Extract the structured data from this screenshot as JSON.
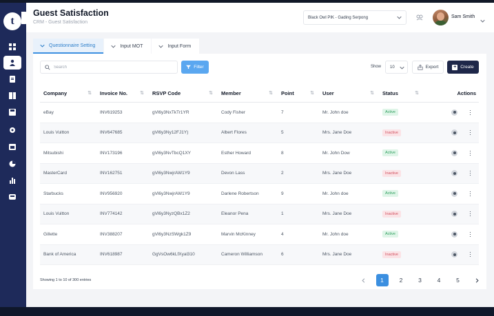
{
  "header": {
    "title": "Guest Satisfaction",
    "breadcrumb": "CRM - Guest Satisfaction",
    "location": "Black Owl PIK - Gading Serpong",
    "user_name": "Sam Smith"
  },
  "tabs": [
    {
      "label": "Questionnaire Setting",
      "active": true
    },
    {
      "label": "Input MOT",
      "active": false
    },
    {
      "label": "Input Form",
      "active": false
    }
  ],
  "toolbar": {
    "search_placeholder": "Search",
    "filter_label": "Filter",
    "show_label": "Show",
    "show_value": "10",
    "export_label": "Export",
    "create_label": "Create"
  },
  "table": {
    "columns": [
      "Company",
      "Invoice No.",
      "RSVP Code",
      "Member",
      "Point",
      "User",
      "Status",
      "Actions"
    ],
    "rows": [
      {
        "company": "eBay",
        "invoice": "INV619253",
        "rsvp": "gVl6y3NxTkTr1YR",
        "member": "Cody Fisher",
        "point": "7",
        "user": "Mr. John doe",
        "status": "Active"
      },
      {
        "company": "Louis Vuitton",
        "invoice": "INV647685",
        "rsvp": "gVl6y3Ny12FJ1Y)",
        "member": "Albert Flores",
        "point": "5",
        "user": "Mrs. Jane Doe",
        "status": "Inactive"
      },
      {
        "company": "Mitsubishi",
        "invoice": "INV173196",
        "rsvp": "gVl6y3NvTbcQ1XY",
        "member": "Esther Howard",
        "point": "8",
        "user": "Mr. John Dow",
        "status": "Active"
      },
      {
        "company": "MasterCard",
        "invoice": "INV162751",
        "rsvp": "gVl6y3NwjrAW1Y9",
        "member": "Devon Lass",
        "point": "2",
        "user": "Mrs. Jane Doe",
        "status": "Inactive"
      },
      {
        "company": "Starbucks",
        "invoice": "INV956920",
        "rsvp": "gVl6y3NwjrAW1Y9",
        "member": "Darlene Robertson",
        "point": "9",
        "user": "Mr. John doe",
        "status": "Active"
      },
      {
        "company": "Louis Vuitton",
        "invoice": "INV774142",
        "rsvp": "gVl6y3NyzQBx1Z2",
        "member": "Eleanor Pena",
        "point": "1",
        "user": "Mrs. Jane Doe",
        "status": "Inactive"
      },
      {
        "company": "Gillette",
        "invoice": "INV388207",
        "rsvp": "gVl6y3NzSWgk1Z9",
        "member": "Marvin McKinney",
        "point": "4",
        "user": "Mr. John doe",
        "status": "Active"
      },
      {
        "company": "Bank of America",
        "invoice": "INV618987",
        "rsvp": "GgVsOw6kLfXyal310",
        "member": "Cameron Williamson",
        "point": "6",
        "user": "Mrs. Jane Doe",
        "status": "Inactive"
      }
    ]
  },
  "footer": {
    "entries_text": "Showing 1 to 10 of 300 entries",
    "pages": [
      "1",
      "2",
      "3",
      "4",
      "5"
    ],
    "current_page": "1"
  },
  "colors": {
    "sidebar": "#1e2a5a",
    "accent": "#3b8fe0",
    "create_button": "#1e2749",
    "active_badge": "#2f9e5e",
    "inactive_badge": "#d0505f"
  },
  "icons": {
    "sidebar": [
      "dashboard-icon",
      "user-icon",
      "document-icon",
      "book-icon",
      "save-icon",
      "settings-icon",
      "calendar-icon",
      "chart-pie-icon",
      "bar-chart-icon",
      "inbox-icon"
    ]
  }
}
